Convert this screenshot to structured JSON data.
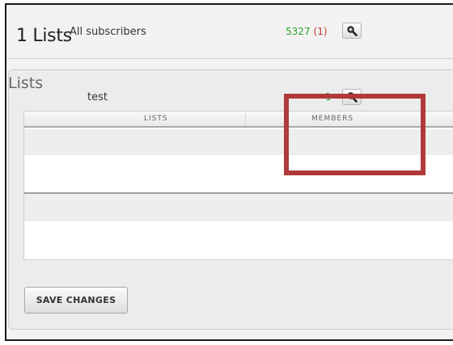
{
  "page": {
    "title": "1 Lists"
  },
  "panel": {
    "title": "Lists"
  },
  "table": {
    "columns": [
      "LISTS",
      "MEMBERS"
    ],
    "rows": [
      {
        "name": "All subscribers",
        "count": "5327",
        "pending": "(1)"
      },
      {
        "name": "test",
        "count": "1",
        "pending": ""
      }
    ]
  },
  "actions": {
    "save_label": "SAVE CHANGES"
  },
  "icons": {
    "view_members": "magnifier-plus-icon"
  },
  "colors": {
    "count": "#2ca52c",
    "pending": "#c0392b",
    "highlight": "#b03a3a"
  }
}
